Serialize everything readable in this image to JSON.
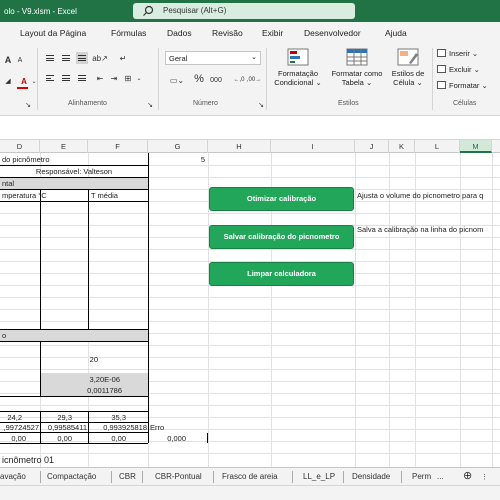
{
  "window": {
    "title": "olo - V9.xlsm - Excel",
    "search_placeholder": "Pesquisar (Alt+G)"
  },
  "menu_tabs": [
    "Layout da Página",
    "Fórmulas",
    "Dados",
    "Revisão",
    "Exibir",
    "Desenvolvedor",
    "Ajuda"
  ],
  "ribbon": {
    "number_format": "Geral",
    "group_alignment": "Alinhamento",
    "group_number": "Número",
    "group_styles": "Estilos",
    "group_cells": "Células",
    "cond_format": [
      "Formatação",
      "Condicional"
    ],
    "format_table": [
      "Formatar como",
      "Tabela"
    ],
    "cell_styles": [
      "Estilos de",
      "Célula"
    ],
    "insert": "Inserir",
    "delete": "Excluir",
    "format": "Formatar",
    "percent": "%",
    "thousands": "000"
  },
  "columns": [
    "D",
    "E",
    "F",
    "G",
    "H",
    "I",
    "J",
    "K",
    "L",
    "M"
  ],
  "cells": {
    "title": "do picnômetro",
    "g1": "5",
    "responsavel": "Responsável: Valteson",
    "section_ntal": "ntal",
    "hdr_temp": "mperatura °C",
    "hdr_tmedia": "T média",
    "section_o": "o",
    "v20": "20",
    "v320e": "3,20E-06",
    "v0011786": "0,0011786",
    "d_242": "24,2",
    "e_293": "29,3",
    "f_353": "35,3",
    "d_997": ",99724527",
    "e_995": "0,99585411",
    "f_993": "0,993925818",
    "erro": "Erro",
    "d_000": "0,00",
    "e_000": "0,00",
    "f_000": "0,00",
    "g_000": "0,000",
    "bottom_title": "icnômetro 01"
  },
  "macros": {
    "btn1": "Otimizar calibração",
    "btn2": "Salvar calibração do picnometro",
    "btn3": "Limpar calculadora"
  },
  "notes": {
    "note1": "Ajusta o volume do picnometro para q",
    "note2": "Salva a calibração na linha do picnom"
  },
  "sheet_tabs": [
    "avação",
    "Compactação",
    "CBR",
    "CBR-Pontual",
    "Frasco de areia",
    "LL_e_LP",
    "Densidade",
    "Perm"
  ],
  "sheet_more": "...",
  "colors": {
    "excel_green": "#217346",
    "button_green": "#21a65a"
  }
}
